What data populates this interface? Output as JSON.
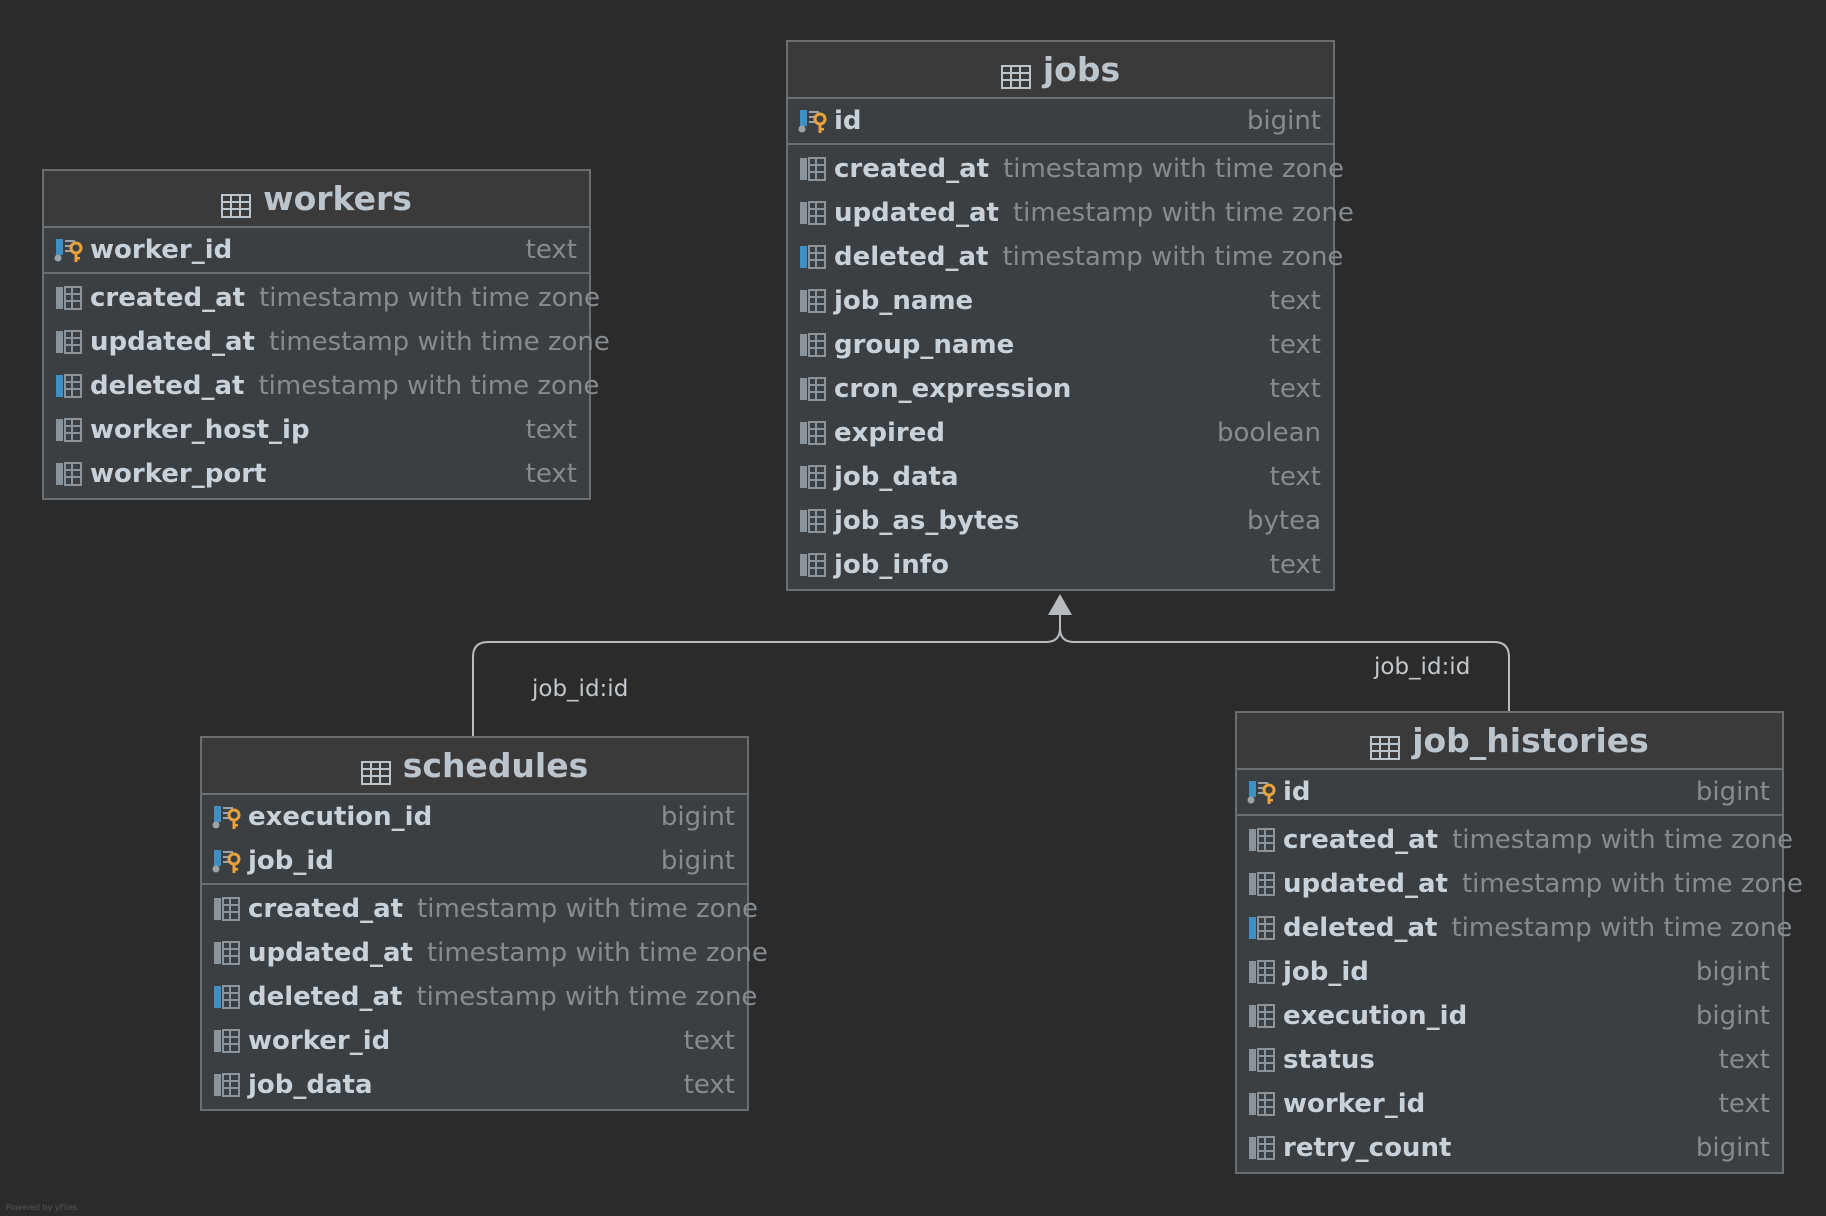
{
  "tables": [
    {
      "id": "workers",
      "name": "workers",
      "pk_columns": [
        {
          "name": "worker_id",
          "type": "text",
          "icon": "primary-key-icon"
        }
      ],
      "columns": [
        {
          "name": "created_at",
          "type": "timestamp with time zone",
          "icon": "column-icon"
        },
        {
          "name": "updated_at",
          "type": "timestamp with time zone",
          "icon": "column-icon"
        },
        {
          "name": "deleted_at",
          "type": "timestamp with time zone",
          "icon": "indexed-column-icon"
        },
        {
          "name": "worker_host_ip",
          "type": "text",
          "icon": "column-icon"
        },
        {
          "name": "worker_port",
          "type": "text",
          "icon": "column-icon"
        }
      ]
    },
    {
      "id": "jobs",
      "name": "jobs",
      "pk_columns": [
        {
          "name": "id",
          "type": "bigint",
          "icon": "primary-key-icon"
        }
      ],
      "columns": [
        {
          "name": "created_at",
          "type": "timestamp with time zone",
          "icon": "column-icon"
        },
        {
          "name": "updated_at",
          "type": "timestamp with time zone",
          "icon": "column-icon"
        },
        {
          "name": "deleted_at",
          "type": "timestamp with time zone",
          "icon": "indexed-column-icon"
        },
        {
          "name": "job_name",
          "type": "text",
          "icon": "column-icon"
        },
        {
          "name": "group_name",
          "type": "text",
          "icon": "column-icon"
        },
        {
          "name": "cron_expression",
          "type": "text",
          "icon": "column-icon"
        },
        {
          "name": "expired",
          "type": "boolean",
          "icon": "column-icon"
        },
        {
          "name": "job_data",
          "type": "text",
          "icon": "column-icon"
        },
        {
          "name": "job_as_bytes",
          "type": "bytea",
          "icon": "column-icon"
        },
        {
          "name": "job_info",
          "type": "text",
          "icon": "column-icon"
        }
      ]
    },
    {
      "id": "schedules",
      "name": "schedules",
      "pk_columns": [
        {
          "name": "execution_id",
          "type": "bigint",
          "icon": "primary-key-icon"
        },
        {
          "name": "job_id",
          "type": "bigint",
          "icon": "primary-key-icon"
        }
      ],
      "columns": [
        {
          "name": "created_at",
          "type": "timestamp with time zone",
          "icon": "column-icon"
        },
        {
          "name": "updated_at",
          "type": "timestamp with time zone",
          "icon": "column-icon"
        },
        {
          "name": "deleted_at",
          "type": "timestamp with time zone",
          "icon": "indexed-column-icon"
        },
        {
          "name": "worker_id",
          "type": "text",
          "icon": "column-icon"
        },
        {
          "name": "job_data",
          "type": "text",
          "icon": "column-icon"
        }
      ]
    },
    {
      "id": "job_histories",
      "name": "job_histories",
      "pk_columns": [
        {
          "name": "id",
          "type": "bigint",
          "icon": "primary-key-icon"
        }
      ],
      "columns": [
        {
          "name": "created_at",
          "type": "timestamp with time zone",
          "icon": "column-icon"
        },
        {
          "name": "updated_at",
          "type": "timestamp with time zone",
          "icon": "column-icon"
        },
        {
          "name": "deleted_at",
          "type": "timestamp with time zone",
          "icon": "indexed-column-icon"
        },
        {
          "name": "job_id",
          "type": "bigint",
          "icon": "column-icon"
        },
        {
          "name": "execution_id",
          "type": "bigint",
          "icon": "column-icon"
        },
        {
          "name": "status",
          "type": "text",
          "icon": "column-icon"
        },
        {
          "name": "worker_id",
          "type": "text",
          "icon": "column-icon"
        },
        {
          "name": "retry_count",
          "type": "bigint",
          "icon": "column-icon"
        }
      ]
    }
  ],
  "relations": [
    {
      "from": "schedules",
      "to": "jobs",
      "label": "job_id:id"
    },
    {
      "from": "job_histories",
      "to": "jobs",
      "label": "job_id:id"
    }
  ],
  "colors": {
    "background": "#2b2b2b",
    "table_body": "#3c3f41",
    "border": "#6b6e70",
    "column_name": "#c9d1d9",
    "column_type": "#858b90",
    "key_gold": "#e8a33d",
    "index_blue": "#3d8fc4",
    "connector": "#b8bcc0"
  },
  "footer": {
    "credit": "Powered by yFiles"
  }
}
